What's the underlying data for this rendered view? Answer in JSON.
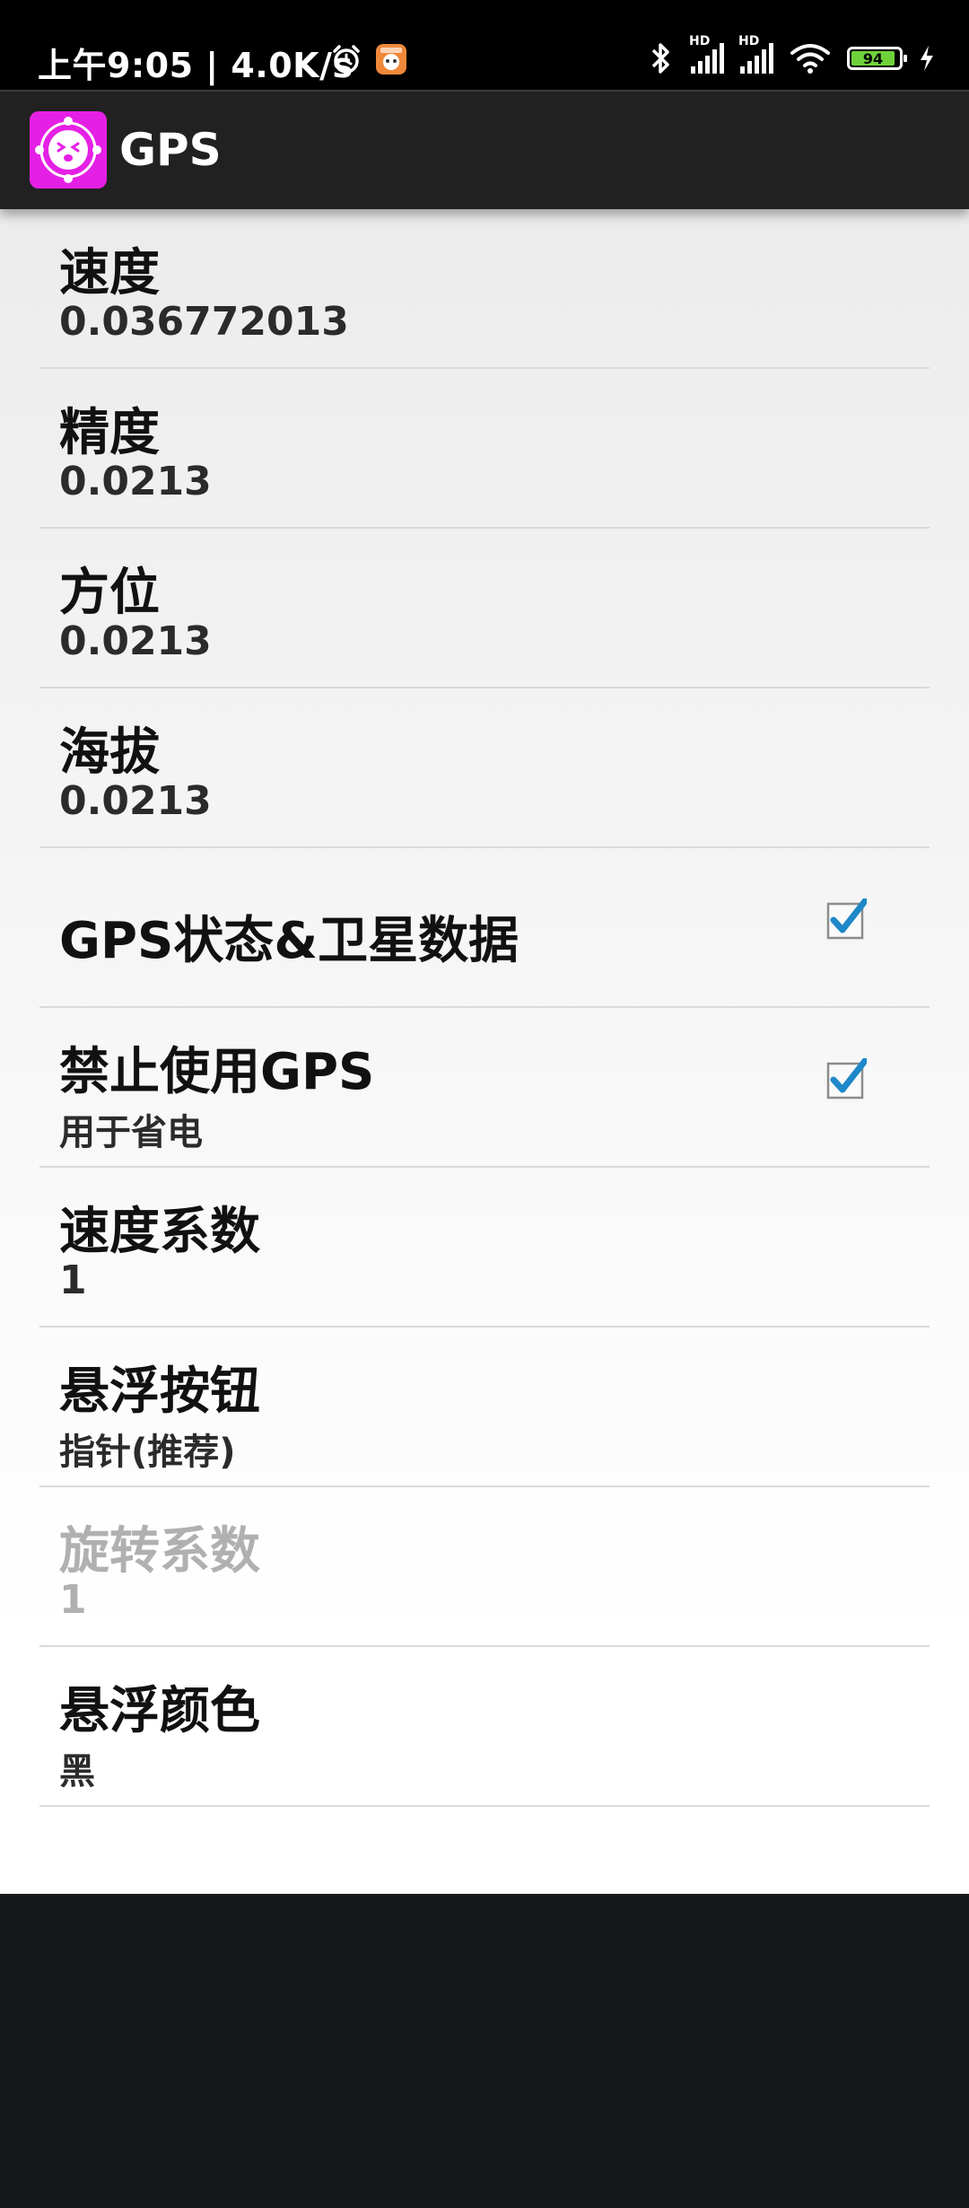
{
  "status_bar": {
    "time": "上午9:05 | 4.0K/s",
    "battery": "94",
    "hd_label": "HD"
  },
  "app_bar": {
    "title": "GPS"
  },
  "preferences": [
    {
      "title": "速度",
      "summary": "0.036772013"
    },
    {
      "title": "精度",
      "summary": "0.0213"
    },
    {
      "title": "方位",
      "summary": "0.0213"
    },
    {
      "title": "海拔",
      "summary": "0.0213"
    },
    {
      "title": "GPS状态&卫星数据",
      "checked": true
    },
    {
      "title": "禁止使用GPS",
      "summary": "用于省电",
      "checked": true
    },
    {
      "title": "速度系数",
      "summary": "1"
    },
    {
      "title": "悬浮按钮",
      "summary": "指针(推荐)"
    },
    {
      "title": "旋转系数",
      "summary": "1",
      "enabled": false
    },
    {
      "title": "悬浮颜色",
      "summary": "黑"
    }
  ],
  "colors": {
    "accent_checkbox": "#1e88c8",
    "app_icon": "#e520e5"
  },
  "icons": [
    "alarm-icon",
    "app-notification-icon",
    "bluetooth-icon",
    "signal-icon",
    "wifi-icon",
    "battery-icon",
    "charging-icon",
    "app-logo-icon",
    "checkbox-checked-icon"
  ]
}
